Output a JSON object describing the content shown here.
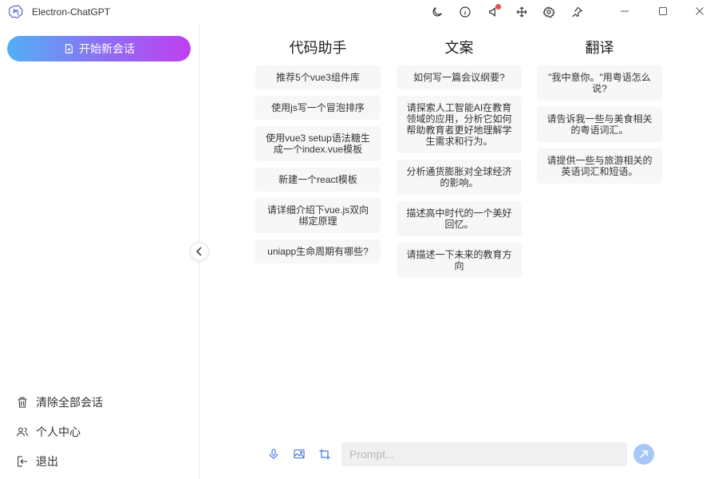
{
  "app": {
    "title": "Electron-ChatGPT"
  },
  "titlebar": {
    "icons": [
      "moon-icon",
      "info-icon",
      "notification-icon",
      "move-icon",
      "settings-icon",
      "pin-icon"
    ],
    "notification_badge_color": "#f04c4c",
    "window_controls": [
      "minimize-icon",
      "maximize-icon",
      "close-icon"
    ]
  },
  "sidebar": {
    "new_chat_label": "开始新会话",
    "menu": [
      {
        "label": "清除全部会话",
        "icon": "trash-icon"
      },
      {
        "label": "个人中心",
        "icon": "users-icon"
      },
      {
        "label": "退出",
        "icon": "logout-icon"
      }
    ]
  },
  "columns": [
    {
      "title": "代码助手",
      "cards": [
        "推荐5个vue3组件库",
        "使用js写一个冒泡排序",
        "使用vue3 setup语法糖生成一个index.vue模板",
        "新建一个react模板",
        "请详细介绍下vue.js双向绑定原理",
        "uniapp生命周期有哪些?"
      ]
    },
    {
      "title": "文案",
      "cards": [
        "如何写一篇会议纲要?",
        "请探索人工智能AI在教育领域的应用，分析它如何帮助教育者更好地理解学生需求和行为。",
        "分析通货膨胀对全球经济的影响。",
        "描述高中时代的一个美好回忆。",
        "请描述一下未来的教育方向"
      ]
    },
    {
      "title": "翻译",
      "cards": [
        "\"我中意你。\"用粤语怎么说?",
        "请告诉我一些与美食相关的粤语词汇。",
        "请提供一些与旅游相关的英语词汇和短语。"
      ]
    }
  ],
  "input": {
    "placeholder": "Prompt...",
    "value": ""
  },
  "toolbar": {
    "icons": [
      "microphone-icon",
      "image-icon",
      "crop-icon"
    ]
  },
  "colors": {
    "gradient_start": "#52b0f5",
    "gradient_end": "#c03ff1",
    "send_button": "#a8c6f7"
  }
}
